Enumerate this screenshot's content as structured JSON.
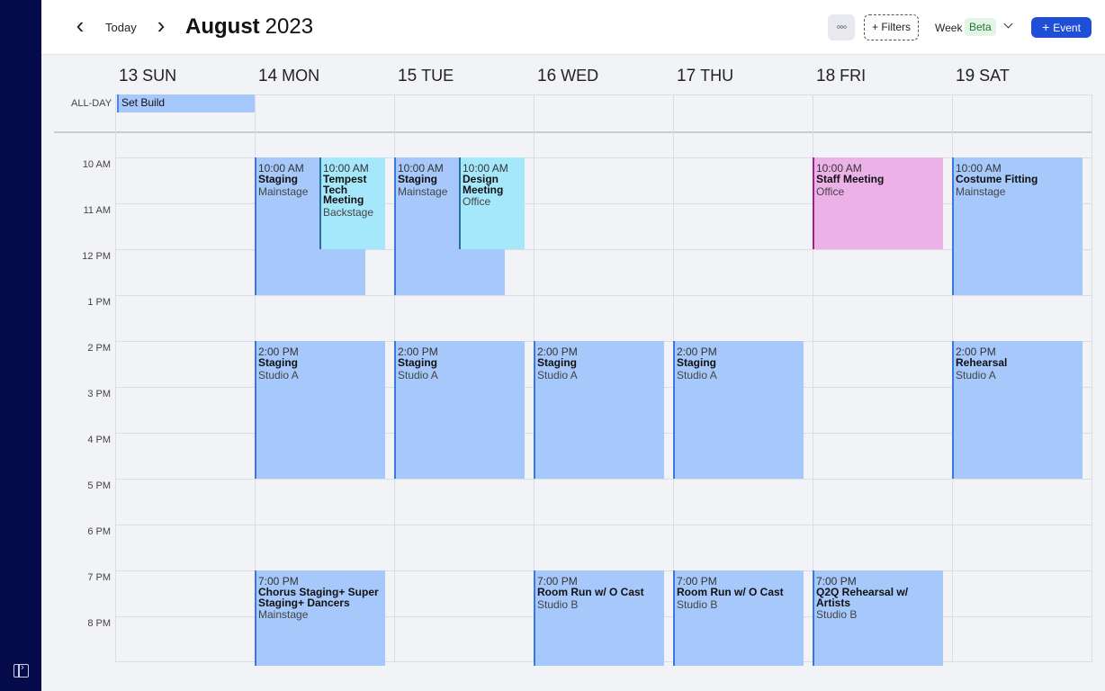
{
  "header": {
    "prev_label": "‹",
    "today_label": "Today",
    "next_label": "›",
    "month": "August",
    "year": "2023",
    "more_label": "◦◦◦",
    "filters_label": "+ Filters",
    "view_label": "Week",
    "beta_label": "Beta",
    "add_event_label": "Event"
  },
  "days": [
    {
      "num": "13",
      "name": "SUN"
    },
    {
      "num": "14",
      "name": "MON"
    },
    {
      "num": "15",
      "name": "TUE"
    },
    {
      "num": "16",
      "name": "WED"
    },
    {
      "num": "17",
      "name": "THU"
    },
    {
      "num": "18",
      "name": "FRI"
    },
    {
      "num": "19",
      "name": "SAT"
    }
  ],
  "allday": {
    "label": "ALL-DAY",
    "events": [
      {
        "title": "Set Build",
        "day": "SUN"
      }
    ]
  },
  "times": [
    "10 AM",
    "11 AM",
    "12 PM",
    "1 PM",
    "2 PM",
    "3 PM",
    "4 PM",
    "5 PM",
    "6 PM",
    "7 PM",
    "8 PM"
  ],
  "events": [
    {
      "time": "10:00 AM",
      "title": "Staging",
      "location": "Mainstage",
      "day": "MON"
    },
    {
      "time": "10:00 AM",
      "title": "Tempest Tech Meeting",
      "location": "Backstage",
      "day": "MON"
    },
    {
      "time": "10:00 AM",
      "title": "Staging",
      "location": "Mainstage",
      "day": "TUE"
    },
    {
      "time": "10:00 AM",
      "title": "Design Meeting",
      "location": "Office",
      "day": "TUE"
    },
    {
      "time": "10:00 AM",
      "title": "Staff Meeting",
      "location": "Office",
      "day": "FRI"
    },
    {
      "time": "10:00 AM",
      "title": "Costume Fitting",
      "location": "Mainstage",
      "day": "SAT"
    },
    {
      "time": "2:00 PM",
      "title": "Staging",
      "location": "Studio A",
      "day": "MON"
    },
    {
      "time": "2:00 PM",
      "title": "Staging",
      "location": "Studio A",
      "day": "TUE"
    },
    {
      "time": "2:00 PM",
      "title": "Staging",
      "location": "Studio A",
      "day": "WED"
    },
    {
      "time": "2:00 PM",
      "title": "Staging",
      "location": "Studio A",
      "day": "THU"
    },
    {
      "time": "2:00 PM",
      "title": "Rehearsal",
      "location": "Studio A",
      "day": "SAT"
    },
    {
      "time": "7:00 PM",
      "title": "Chorus Staging+ Super Staging+ Dancers",
      "location": "Mainstage",
      "day": "MON"
    },
    {
      "time": "7:00 PM",
      "title": "Room Run w/ O Cast",
      "location": "Studio B",
      "day": "WED"
    },
    {
      "time": "7:00 PM",
      "title": "Room Run w/ O Cast",
      "location": "Studio B",
      "day": "THU"
    },
    {
      "time": "7:00 PM",
      "title": "Q2Q Rehearsal w/ Artists",
      "location": "Studio B",
      "day": "FRI"
    }
  ],
  "colors": {
    "sidebar": "#050a4a",
    "event_blue": "#a6c8fb",
    "event_cyan": "#a6e8fb",
    "event_pink": "#ecb2e8",
    "accent": "#1e4fd6",
    "beta_badge": "#e3f5e6"
  }
}
